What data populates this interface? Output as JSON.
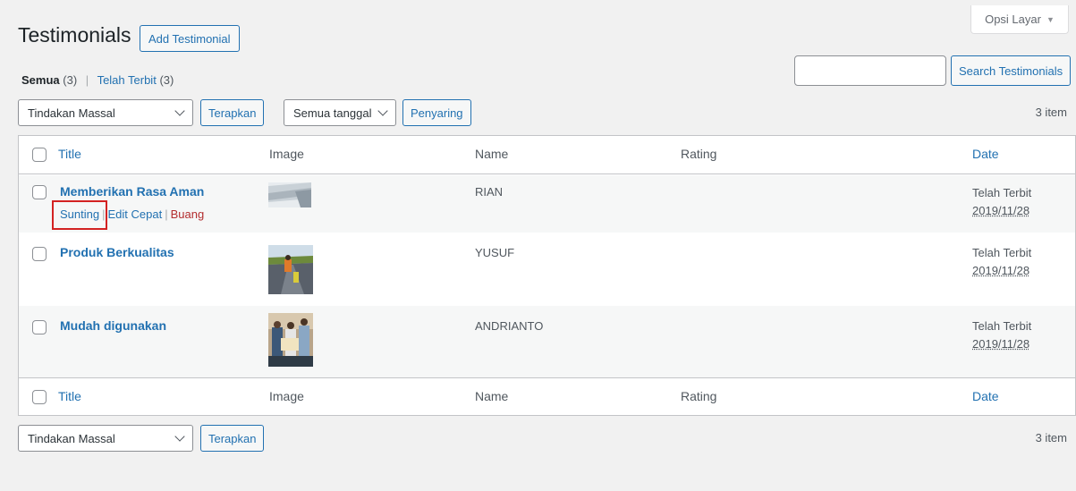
{
  "screen_options": {
    "label": "Opsi Layar"
  },
  "header": {
    "title": "Testimonials",
    "add_button": "Add Testimonial"
  },
  "filters": {
    "all_label": "Semua",
    "all_count": "(3)",
    "published_label": "Telah Terbit",
    "published_count": "(3)",
    "separator": "|"
  },
  "search": {
    "value": "",
    "button": "Search Testimonials"
  },
  "tablenav_top": {
    "bulk_action": "Tindakan Massal",
    "apply": "Terapkan",
    "date_filter": "Semua tanggal",
    "filter_button": "Penyaring",
    "items": "3 item"
  },
  "tablenav_bottom": {
    "bulk_action": "Tindakan Massal",
    "apply": "Terapkan",
    "items": "3 item"
  },
  "columns": {
    "title": "Title",
    "image": "Image",
    "name": "Name",
    "rating": "Rating",
    "date": "Date"
  },
  "row_actions": {
    "edit": "Sunting",
    "quick_edit": "Edit Cepat",
    "trash": "Buang",
    "divider": "|"
  },
  "rows": [
    {
      "title": "Memberikan Rasa Aman",
      "name": "RIAN",
      "status": "Telah Terbit",
      "date": "2019/11/28"
    },
    {
      "title": "Produk Berkualitas",
      "name": "YUSUF",
      "status": "Telah Terbit",
      "date": "2019/11/28"
    },
    {
      "title": "Mudah digunakan",
      "name": "ANDRIANTO",
      "status": "Telah Terbit",
      "date": "2019/11/28"
    }
  ],
  "colors": {
    "accent": "#2271b1",
    "trash": "#b32d2e",
    "highlight": "#d32222"
  }
}
